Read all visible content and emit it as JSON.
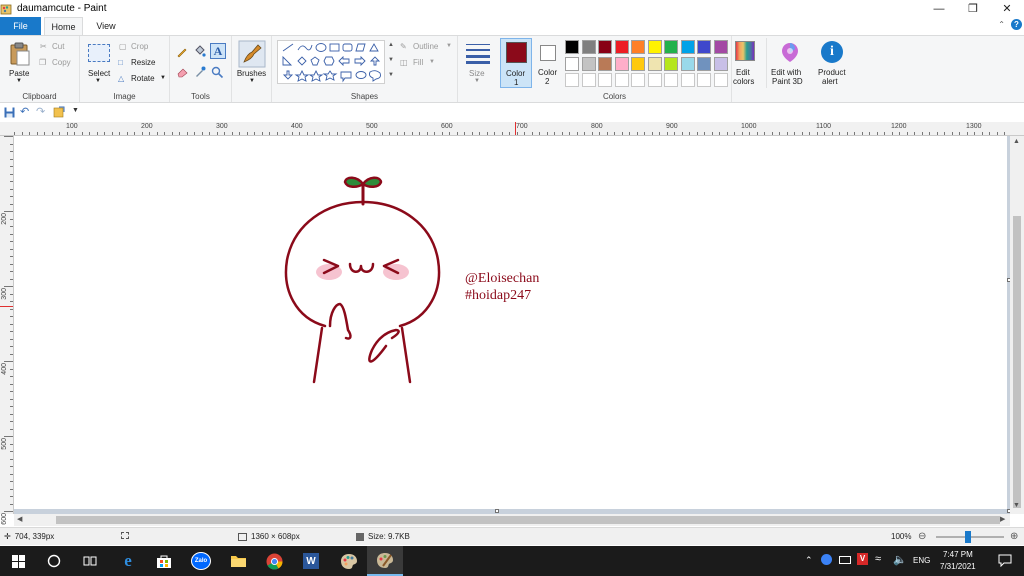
{
  "window": {
    "title": "daumamcute - Paint"
  },
  "tabs": {
    "file": "File",
    "home": "Home",
    "view": "View"
  },
  "ribbon": {
    "clipboard": {
      "paste": "Paste",
      "cut": "Cut",
      "copy": "Copy",
      "label": "Clipboard"
    },
    "image": {
      "select": "Select",
      "crop": "Crop",
      "resize": "Resize",
      "rotate": "Rotate",
      "label": "Image"
    },
    "tools": {
      "label": "Tools"
    },
    "brushes": {
      "label": "Brushes"
    },
    "shapes": {
      "outline": "Outline",
      "fill": "Fill",
      "label": "Shapes"
    },
    "size": {
      "label": "Size"
    },
    "color1": {
      "label": "Color",
      "num": "1",
      "value": "#8b0a1a"
    },
    "color2": {
      "label": "Color",
      "num": "2",
      "value": "#ffffff"
    },
    "colors": {
      "label": "Colors",
      "row1": [
        "#000000",
        "#7f7f7f",
        "#880015",
        "#ed1c24",
        "#ff7f27",
        "#fff200",
        "#22b14c",
        "#00a2e8",
        "#3f48cc",
        "#a349a4"
      ],
      "row2": [
        "#ffffff",
        "#c3c3c3",
        "#b97a57",
        "#ffaec9",
        "#ffc90e",
        "#efe4b0",
        "#b5e61d",
        "#99d9ea",
        "#7092be",
        "#c8bfe7"
      ]
    },
    "edit_colors": {
      "line1": "Edit",
      "line2": "colors"
    },
    "paint3d": {
      "line1": "Edit with",
      "line2": "Paint 3D"
    },
    "product_alert": {
      "line1": "Product",
      "line2": "alert"
    }
  },
  "ruler": {
    "h": [
      "100",
      "200",
      "300",
      "400",
      "500",
      "600",
      "700",
      "800",
      "900",
      "1000",
      "1100",
      "1200",
      "1300"
    ],
    "v": [
      "200",
      "300",
      "400",
      "500",
      "600"
    ]
  },
  "canvas": {
    "text_line1": "@Eloisechan",
    "text_line2": "#hoidap247",
    "stroke_color": "#8b0a1a",
    "blush_color": "#f6c3d0",
    "sprout_color": "#2e8b3a"
  },
  "statusbar": {
    "cursor": "704, 339px",
    "dimensions": "1360 × 608px",
    "size": "Size: 9.7KB",
    "zoom": "100%"
  },
  "taskbar": {
    "language": "ENG",
    "time": "7:47 PM",
    "date": "7/31/2021",
    "zalo_label": "Zalo"
  }
}
